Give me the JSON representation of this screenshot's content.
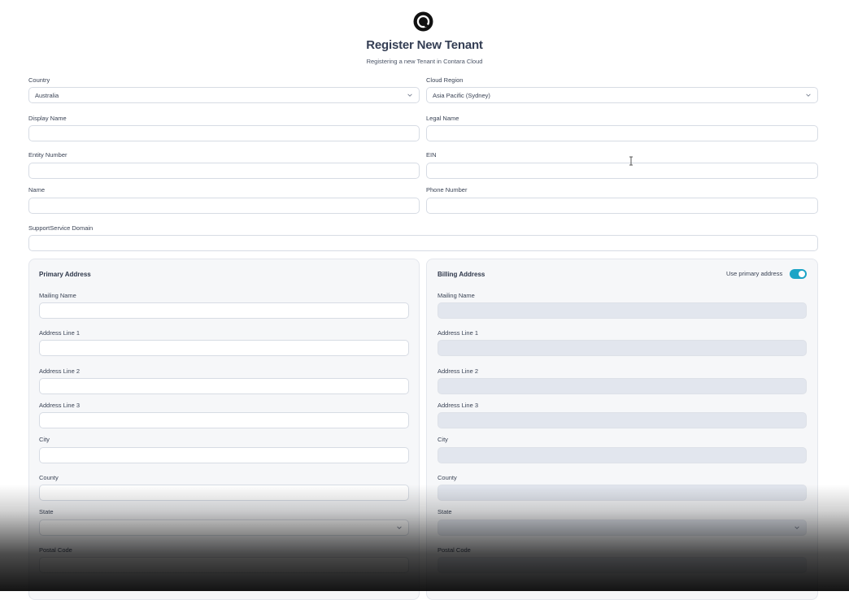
{
  "header": {
    "logo_icon": "contara-logo-icon",
    "title": "Register New Tenant",
    "subtitle": "Registering a new Tenant in Contara Cloud"
  },
  "form": {
    "country": {
      "label": "Country",
      "value": "Australia"
    },
    "cloud_region": {
      "label": "Cloud Region",
      "value": "Asia Pacific (Sydney)"
    },
    "display_name": {
      "label": "Display Name",
      "value": ""
    },
    "legal_name": {
      "label": "Legal Name",
      "value": ""
    },
    "entity_number": {
      "label": "Entity Number",
      "value": ""
    },
    "ein": {
      "label": "EIN",
      "value": ""
    },
    "name": {
      "label": "Name",
      "value": ""
    },
    "phone_number": {
      "label": "Phone Number",
      "value": ""
    },
    "support_service_domain": {
      "label": "SupportService Domain",
      "value": ""
    }
  },
  "primary_address": {
    "title": "Primary Address",
    "mailing_name": "Mailing Name",
    "address_line_1": "Address Line 1",
    "address_line_2": "Address Line 2",
    "address_line_3": "Address Line 3",
    "city": "City",
    "county": "County",
    "state": "State",
    "postal_code": "Postal Code"
  },
  "billing_address": {
    "title": "Billing Address",
    "use_primary_label": "Use primary address",
    "use_primary_enabled": true,
    "mailing_name": "Mailing Name",
    "address_line_1": "Address Line 1",
    "address_line_2": "Address Line 2",
    "address_line_3": "Address Line 3",
    "city": "City",
    "county": "County",
    "state": "State",
    "postal_code": "Postal Code"
  },
  "colors": {
    "accent": "#1ba4c6",
    "disabled_field": "#e2e6ee",
    "panel_background": "#f6f7f9"
  }
}
